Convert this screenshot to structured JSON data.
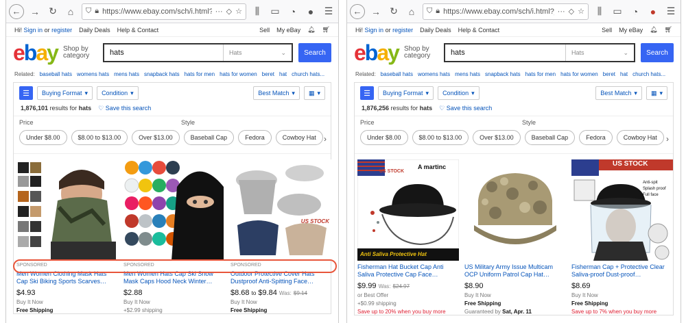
{
  "left": {
    "url": "https://www.ebay.com/sch/i.html?_",
    "topnav": {
      "hi": "Hi!",
      "signin": "Sign in",
      "or": "or",
      "register": "register",
      "daily_deals": "Daily Deals",
      "help": "Help & Contact",
      "sell": "Sell",
      "myebay": "My eBay"
    },
    "shop_by": "Shop by category",
    "search_value": "hats",
    "search_category": "Hats",
    "search_button": "Search",
    "related_label": "Related:",
    "related": [
      "baseball hats",
      "womens hats",
      "mens hats",
      "snapback hats",
      "hats for men",
      "hats for women",
      "beret",
      "hat",
      "church hats..."
    ],
    "filters": {
      "buying_format": "Buying Format",
      "condition": "Condition",
      "sort": "Best Match"
    },
    "result_count": "1,876,101",
    "results_for": "results for",
    "query": "hats",
    "save_search": "Save this search",
    "facet_price": "Price",
    "facet_style": "Style",
    "price_chips": [
      "Under $8.00",
      "$8.00 to $13.00",
      "Over $13.00"
    ],
    "style_chips": [
      "Baseball Cap",
      "Fedora",
      "Cowboy Hat"
    ],
    "items": [
      {
        "sponsored": "SPONSORED",
        "title": "Men Women Clothing Mask Hats Cap Ski Biking Sports Scarves…",
        "price": "$4.93",
        "buy": "Buy It Now",
        "ship": "Free Shipping"
      },
      {
        "sponsored": "SPONSORED",
        "title": "Men Women Hats Cap Ski Snow Mask Caps Hood Neck Winter…",
        "price": "$2.88",
        "buy": "Buy It Now",
        "ship": "+$2.99 shipping"
      },
      {
        "sponsored": "SPONSORED",
        "title": "Outdoor Protective Cover Hats Dustproof Anti-Spitting Face…",
        "price": "$8.68",
        "price_to": "to",
        "price2": "$9.84",
        "was_label": "Was:",
        "was": "$9.14",
        "buy": "Buy It Now",
        "ship": "Free Shipping",
        "badge": "US STOCK"
      }
    ]
  },
  "right": {
    "url": "https://www.ebay.com/sch/i.html?_",
    "topnav": {
      "hi": "Hi!",
      "signin": "Sign in",
      "or": "or",
      "register": "register",
      "daily_deals": "Daily Deals",
      "help": "Help & Contact",
      "sell": "Sell",
      "myebay": "My eBay"
    },
    "shop_by": "Shop by category",
    "search_value": "hats",
    "search_category": "Hats",
    "search_button": "Search",
    "related_label": "Related:",
    "related": [
      "baseball hats",
      "womens hats",
      "mens hats",
      "snapback hats",
      "hats for men",
      "hats for women",
      "beret",
      "hat",
      "church hats..."
    ],
    "filters": {
      "buying_format": "Buying Format",
      "condition": "Condition",
      "sort": "Best Match"
    },
    "result_count": "1,876,256",
    "results_for": "results for",
    "query": "hats",
    "save_search": "Save this search",
    "facet_price": "Price",
    "facet_style": "Style",
    "price_chips": [
      "Under $8.00",
      "$8.00 to $13.00",
      "Over $13.00"
    ],
    "style_chips": [
      "Baseball Cap",
      "Fedora",
      "Cowboy Hat"
    ],
    "items": [
      {
        "title": "Fisherman Hat Bucket Cap Anti Saliva Protective Cap Face…",
        "price": "$9.99",
        "was_label": "Was:",
        "was": "$24.97",
        "offer": "or Best Offer",
        "ship": "+$0.99 shipping",
        "promo": "Save up to 20% when you buy more",
        "badge": "US STOCK",
        "brand": "A martinc",
        "banner": "Anti Saliva Protective Hat"
      },
      {
        "title": "US Military Army Issue Multicam OCP Uniform Patrol Cap Hat…",
        "price": "$8.90",
        "buy": "Buy It Now",
        "ship": "Free Shipping",
        "guaranteed": "Guaranteed by",
        "guaranteed_date": "Sat, Apr. 11"
      },
      {
        "title": "Fisherman Cap + Protective Clear Saliva-proof Dust-proof…",
        "price": "$8.69",
        "buy": "Buy It Now",
        "ship": "Free Shipping",
        "promo": "Save up to 7% when you buy more",
        "badge": "US STOCK",
        "features": [
          "Anti-spit",
          "Splash proof",
          "Full face"
        ]
      }
    ]
  },
  "colors": {
    "accent": "#3665f3",
    "link": "#0654ba",
    "highlight": "#e8553a",
    "promo": "#dd1e31"
  }
}
